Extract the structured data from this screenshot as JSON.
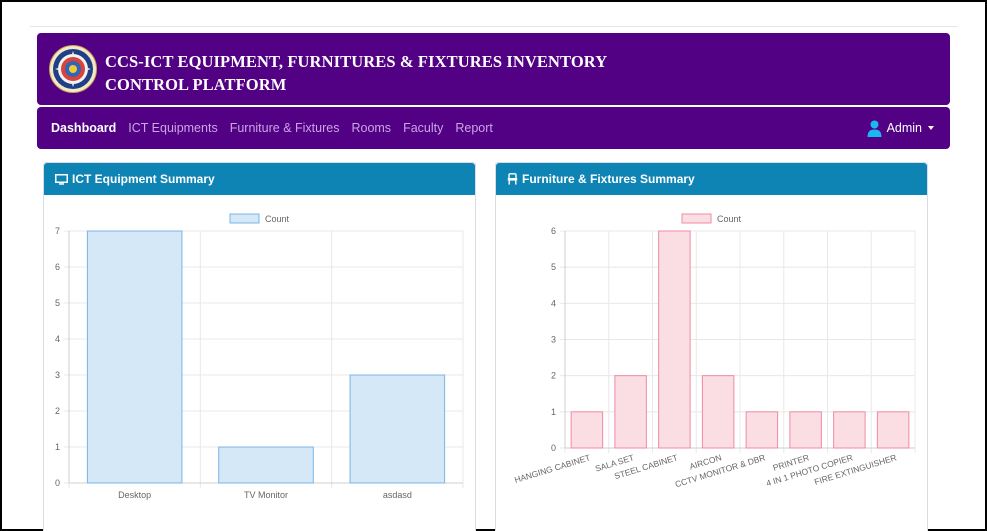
{
  "banner": {
    "title_line1": "CCS-ICT EQUIPMENT, FURNITURES & FIXTURES INVENTORY",
    "title_line2": "CONTROL PLATFORM"
  },
  "nav": {
    "items": [
      {
        "label": "Dashboard",
        "active": true
      },
      {
        "label": "ICT Equipments",
        "active": false
      },
      {
        "label": "Furniture & Fixtures",
        "active": false
      },
      {
        "label": "Rooms",
        "active": false
      },
      {
        "label": "Faculty",
        "active": false
      },
      {
        "label": "Report",
        "active": false
      }
    ],
    "user_label": "Admin"
  },
  "cards": {
    "ict_title": "ICT Equipment Summary",
    "ff_title": "Furniture & Fixtures Summary"
  },
  "colors": {
    "purple": "#520084",
    "header_blue": "#0e84b5",
    "ict_bar_fill": "#d4e8f8",
    "ict_bar_stroke": "#7cb4e4",
    "ff_bar_fill": "#fbdde4",
    "ff_bar_stroke": "#f08aa4"
  },
  "chart_data": [
    {
      "type": "bar",
      "legend": [
        "Count"
      ],
      "legend_position": "top",
      "categories": [
        "Desktop",
        "TV Monitor",
        "asdasd"
      ],
      "series": [
        {
          "name": "Count",
          "values": [
            7,
            1,
            3
          ]
        }
      ],
      "ylim": [
        0,
        7
      ],
      "yticks": [
        0,
        1,
        2,
        3,
        4,
        5,
        6,
        7
      ],
      "grid": true
    },
    {
      "type": "bar",
      "legend": [
        "Count"
      ],
      "legend_position": "top",
      "categories": [
        "HANGING CABINET",
        "SALA SET",
        "STEEL CABINET",
        "AIRCON",
        "CCTV MONITOR & DBR",
        "PRINTER",
        "4 IN 1 PHOTO COPIER",
        "FIRE EXTINGUISHER"
      ],
      "series": [
        {
          "name": "Count",
          "values": [
            1,
            2,
            6,
            2,
            1,
            1,
            1,
            1
          ]
        }
      ],
      "ylim": [
        0,
        6
      ],
      "yticks": [
        0,
        1,
        2,
        3,
        4,
        5,
        6
      ],
      "grid": true
    }
  ]
}
